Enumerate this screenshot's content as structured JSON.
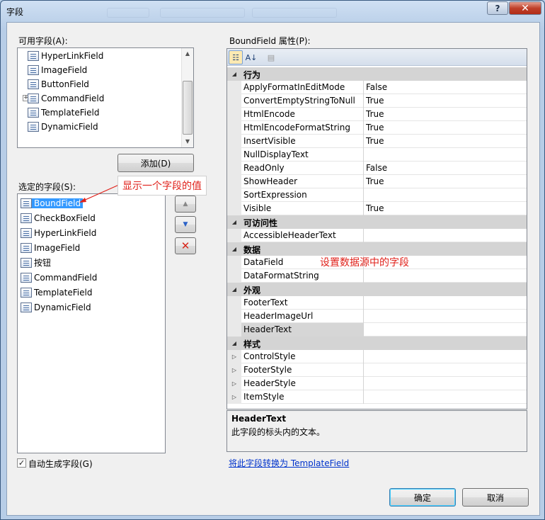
{
  "window": {
    "title": "字段",
    "help_glyph": "?",
    "close_glyph": "✕"
  },
  "available": {
    "label": "可用字段(A):",
    "items": [
      {
        "label": "HyperLinkField",
        "icon": "hyperlink-field-icon"
      },
      {
        "label": "ImageField",
        "icon": "image-field-icon"
      },
      {
        "label": "ButtonField",
        "icon": "button-field-icon"
      },
      {
        "label": "CommandField",
        "icon": "command-field-icon",
        "expandable": true
      },
      {
        "label": "TemplateField",
        "icon": "template-field-icon"
      },
      {
        "label": "DynamicField",
        "icon": "dynamic-field-icon"
      }
    ],
    "add_label": "添加(D)"
  },
  "selected": {
    "label": "选定的字段(S):",
    "items": [
      {
        "label": "BoundField",
        "icon": "bound-field-icon",
        "selected": true
      },
      {
        "label": "CheckBoxField",
        "icon": "checkbox-field-icon"
      },
      {
        "label": "HyperLinkField",
        "icon": "hyperlink-field-icon"
      },
      {
        "label": "ImageField",
        "icon": "image-field-icon"
      },
      {
        "label": "按钮",
        "icon": "button-field-icon"
      },
      {
        "label": "CommandField",
        "icon": "command-field-icon"
      },
      {
        "label": "TemplateField",
        "icon": "template-field-icon"
      },
      {
        "label": "DynamicField",
        "icon": "dynamic-field-icon"
      }
    ],
    "move_up_glyph": "▲",
    "move_down_glyph": "▼",
    "delete_glyph": "✕"
  },
  "callout": {
    "text": "显示一个字段的值"
  },
  "annotation": {
    "text": "设置数据源中的字段"
  },
  "properties": {
    "label": "BoundField 属性(P):",
    "groups": [
      {
        "name": "行为",
        "rows": [
          {
            "name": "ApplyFormatInEditMode",
            "value": "False"
          },
          {
            "name": "ConvertEmptyStringToNull",
            "value": "True"
          },
          {
            "name": "HtmlEncode",
            "value": "True"
          },
          {
            "name": "HtmlEncodeFormatString",
            "value": "True"
          },
          {
            "name": "InsertVisible",
            "value": "True"
          },
          {
            "name": "NullDisplayText",
            "value": ""
          },
          {
            "name": "ReadOnly",
            "value": "False"
          },
          {
            "name": "ShowHeader",
            "value": "True"
          },
          {
            "name": "SortExpression",
            "value": ""
          },
          {
            "name": "Visible",
            "value": "True"
          }
        ]
      },
      {
        "name": "可访问性",
        "rows": [
          {
            "name": "AccessibleHeaderText",
            "value": ""
          }
        ]
      },
      {
        "name": "数据",
        "rows": [
          {
            "name": "DataField",
            "value": ""
          },
          {
            "name": "DataFormatString",
            "value": ""
          }
        ]
      },
      {
        "name": "外观",
        "rows": [
          {
            "name": "FooterText",
            "value": ""
          },
          {
            "name": "HeaderImageUrl",
            "value": ""
          },
          {
            "name": "HeaderText",
            "value": "",
            "selected": true
          }
        ]
      },
      {
        "name": "样式",
        "rows": [
          {
            "name": "ControlStyle",
            "value": "",
            "expandable": true
          },
          {
            "name": "FooterStyle",
            "value": "",
            "expandable": true
          },
          {
            "name": "HeaderStyle",
            "value": "",
            "expandable": true
          },
          {
            "name": "ItemStyle",
            "value": "",
            "expandable": true
          }
        ]
      }
    ],
    "description": {
      "title": "HeaderText",
      "text": "此字段的标头内的文本。"
    }
  },
  "convert_link": "将此字段转换为 TemplateField",
  "auto_generate": {
    "label": "自动生成字段(G)",
    "checked": true
  },
  "footer": {
    "ok_label": "确定",
    "cancel_label": "取消"
  }
}
